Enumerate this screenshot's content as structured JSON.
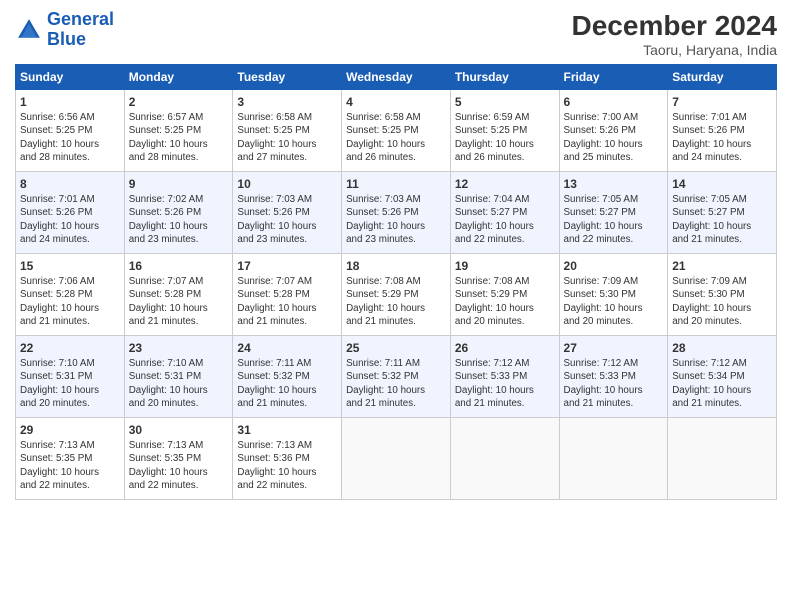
{
  "header": {
    "logo_line1": "General",
    "logo_line2": "Blue",
    "title": "December 2024",
    "subtitle": "Taoru, Haryana, India"
  },
  "weekdays": [
    "Sunday",
    "Monday",
    "Tuesday",
    "Wednesday",
    "Thursday",
    "Friday",
    "Saturday"
  ],
  "weeks": [
    [
      {
        "day": "1",
        "info": "Sunrise: 6:56 AM\nSunset: 5:25 PM\nDaylight: 10 hours\nand 28 minutes."
      },
      {
        "day": "2",
        "info": "Sunrise: 6:57 AM\nSunset: 5:25 PM\nDaylight: 10 hours\nand 28 minutes."
      },
      {
        "day": "3",
        "info": "Sunrise: 6:58 AM\nSunset: 5:25 PM\nDaylight: 10 hours\nand 27 minutes."
      },
      {
        "day": "4",
        "info": "Sunrise: 6:58 AM\nSunset: 5:25 PM\nDaylight: 10 hours\nand 26 minutes."
      },
      {
        "day": "5",
        "info": "Sunrise: 6:59 AM\nSunset: 5:25 PM\nDaylight: 10 hours\nand 26 minutes."
      },
      {
        "day": "6",
        "info": "Sunrise: 7:00 AM\nSunset: 5:26 PM\nDaylight: 10 hours\nand 25 minutes."
      },
      {
        "day": "7",
        "info": "Sunrise: 7:01 AM\nSunset: 5:26 PM\nDaylight: 10 hours\nand 24 minutes."
      }
    ],
    [
      {
        "day": "8",
        "info": "Sunrise: 7:01 AM\nSunset: 5:26 PM\nDaylight: 10 hours\nand 24 minutes."
      },
      {
        "day": "9",
        "info": "Sunrise: 7:02 AM\nSunset: 5:26 PM\nDaylight: 10 hours\nand 23 minutes."
      },
      {
        "day": "10",
        "info": "Sunrise: 7:03 AM\nSunset: 5:26 PM\nDaylight: 10 hours\nand 23 minutes."
      },
      {
        "day": "11",
        "info": "Sunrise: 7:03 AM\nSunset: 5:26 PM\nDaylight: 10 hours\nand 23 minutes."
      },
      {
        "day": "12",
        "info": "Sunrise: 7:04 AM\nSunset: 5:27 PM\nDaylight: 10 hours\nand 22 minutes."
      },
      {
        "day": "13",
        "info": "Sunrise: 7:05 AM\nSunset: 5:27 PM\nDaylight: 10 hours\nand 22 minutes."
      },
      {
        "day": "14",
        "info": "Sunrise: 7:05 AM\nSunset: 5:27 PM\nDaylight: 10 hours\nand 21 minutes."
      }
    ],
    [
      {
        "day": "15",
        "info": "Sunrise: 7:06 AM\nSunset: 5:28 PM\nDaylight: 10 hours\nand 21 minutes."
      },
      {
        "day": "16",
        "info": "Sunrise: 7:07 AM\nSunset: 5:28 PM\nDaylight: 10 hours\nand 21 minutes."
      },
      {
        "day": "17",
        "info": "Sunrise: 7:07 AM\nSunset: 5:28 PM\nDaylight: 10 hours\nand 21 minutes."
      },
      {
        "day": "18",
        "info": "Sunrise: 7:08 AM\nSunset: 5:29 PM\nDaylight: 10 hours\nand 21 minutes."
      },
      {
        "day": "19",
        "info": "Sunrise: 7:08 AM\nSunset: 5:29 PM\nDaylight: 10 hours\nand 20 minutes."
      },
      {
        "day": "20",
        "info": "Sunrise: 7:09 AM\nSunset: 5:30 PM\nDaylight: 10 hours\nand 20 minutes."
      },
      {
        "day": "21",
        "info": "Sunrise: 7:09 AM\nSunset: 5:30 PM\nDaylight: 10 hours\nand 20 minutes."
      }
    ],
    [
      {
        "day": "22",
        "info": "Sunrise: 7:10 AM\nSunset: 5:31 PM\nDaylight: 10 hours\nand 20 minutes."
      },
      {
        "day": "23",
        "info": "Sunrise: 7:10 AM\nSunset: 5:31 PM\nDaylight: 10 hours\nand 20 minutes."
      },
      {
        "day": "24",
        "info": "Sunrise: 7:11 AM\nSunset: 5:32 PM\nDaylight: 10 hours\nand 21 minutes."
      },
      {
        "day": "25",
        "info": "Sunrise: 7:11 AM\nSunset: 5:32 PM\nDaylight: 10 hours\nand 21 minutes."
      },
      {
        "day": "26",
        "info": "Sunrise: 7:12 AM\nSunset: 5:33 PM\nDaylight: 10 hours\nand 21 minutes."
      },
      {
        "day": "27",
        "info": "Sunrise: 7:12 AM\nSunset: 5:33 PM\nDaylight: 10 hours\nand 21 minutes."
      },
      {
        "day": "28",
        "info": "Sunrise: 7:12 AM\nSunset: 5:34 PM\nDaylight: 10 hours\nand 21 minutes."
      }
    ],
    [
      {
        "day": "29",
        "info": "Sunrise: 7:13 AM\nSunset: 5:35 PM\nDaylight: 10 hours\nand 22 minutes."
      },
      {
        "day": "30",
        "info": "Sunrise: 7:13 AM\nSunset: 5:35 PM\nDaylight: 10 hours\nand 22 minutes."
      },
      {
        "day": "31",
        "info": "Sunrise: 7:13 AM\nSunset: 5:36 PM\nDaylight: 10 hours\nand 22 minutes."
      },
      {
        "day": "",
        "info": ""
      },
      {
        "day": "",
        "info": ""
      },
      {
        "day": "",
        "info": ""
      },
      {
        "day": "",
        "info": ""
      }
    ]
  ]
}
